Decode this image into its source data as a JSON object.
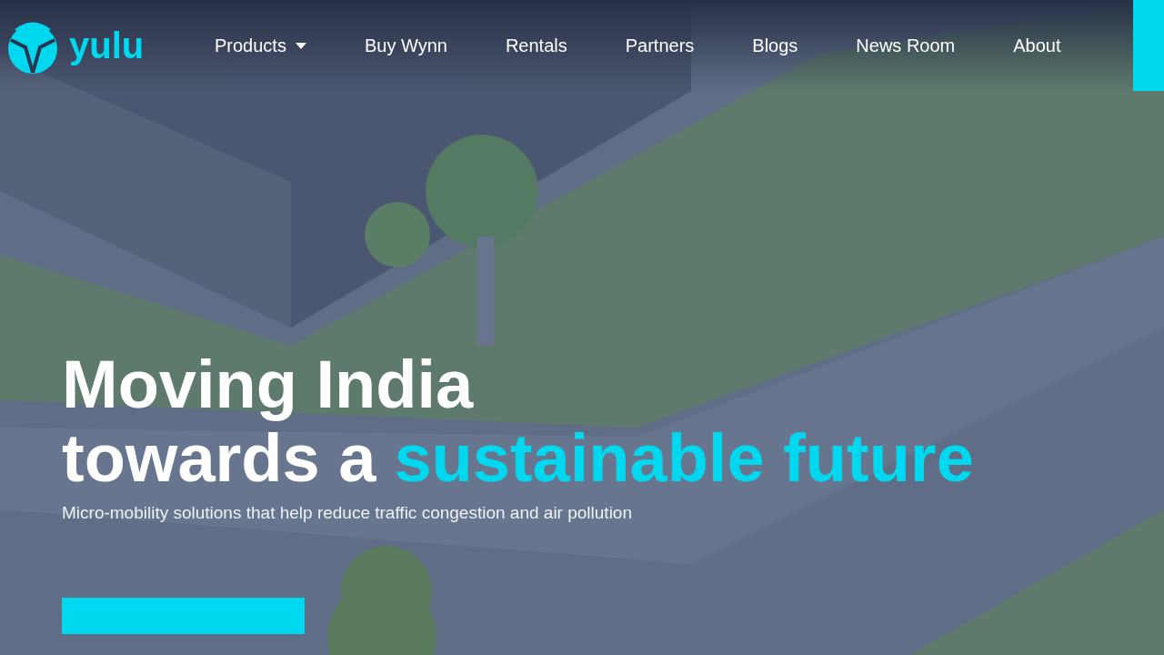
{
  "brand": {
    "name": "yulu"
  },
  "nav": [
    {
      "label": "Products",
      "dropdown": true
    },
    {
      "label": "Buy Wynn",
      "dropdown": false
    },
    {
      "label": "Rentals",
      "dropdown": false
    },
    {
      "label": "Partners",
      "dropdown": false
    },
    {
      "label": "Blogs",
      "dropdown": false
    },
    {
      "label": "News Room",
      "dropdown": false
    },
    {
      "label": "About",
      "dropdown": false
    }
  ],
  "hero": {
    "line_1": "Moving India",
    "line_2": "towards a",
    "highlight": "sustainable future",
    "subtitle": "Micro-mobility solutions that help reduce traffic congestion and air pollution"
  }
}
